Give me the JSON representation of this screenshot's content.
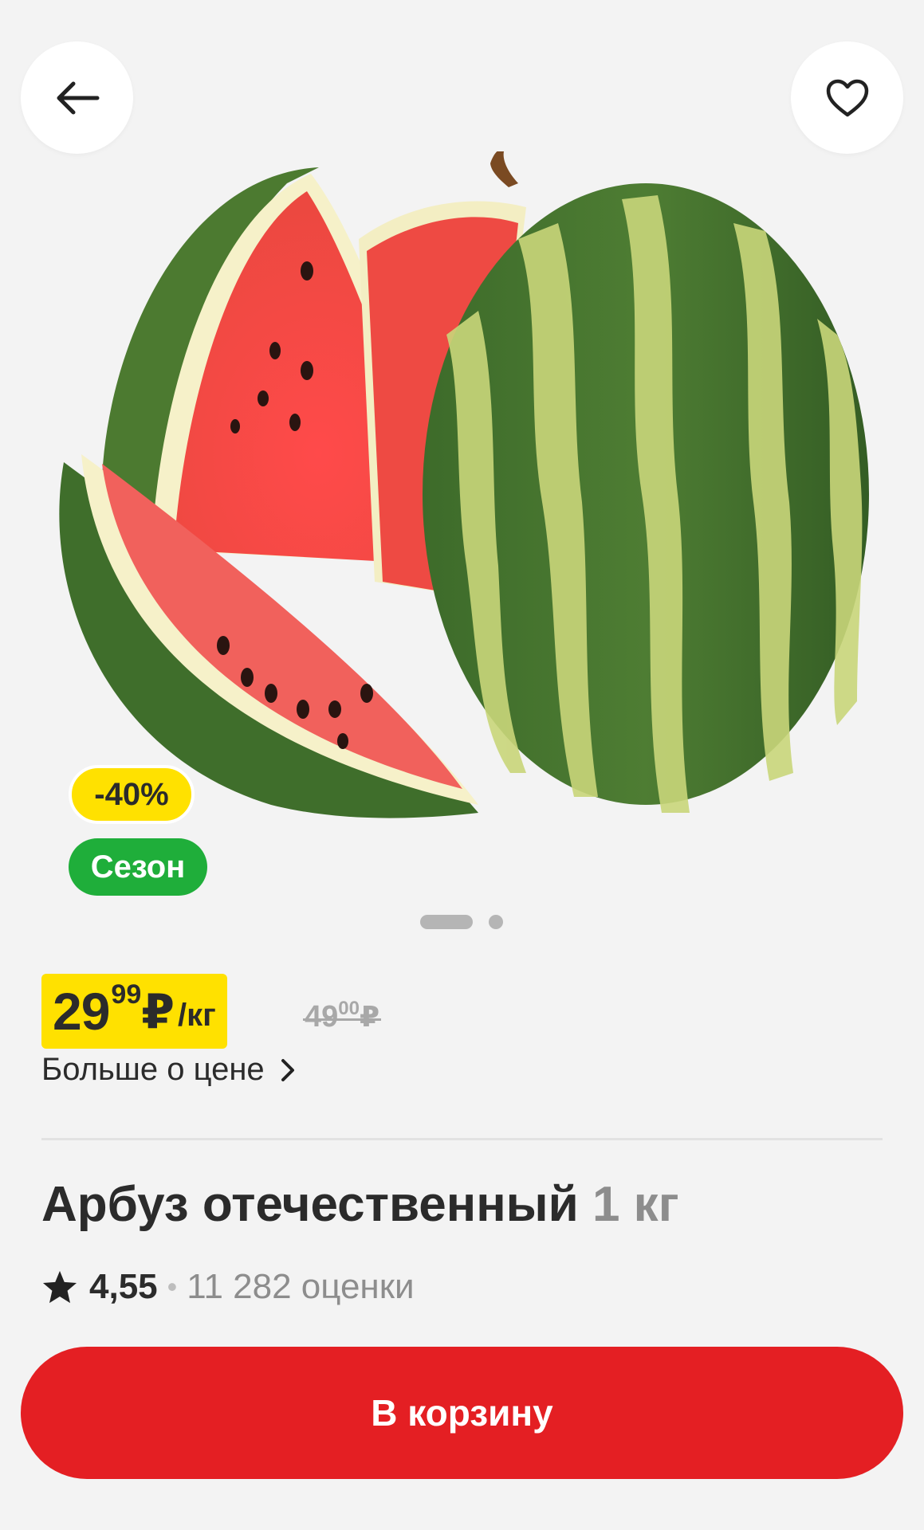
{
  "header": {
    "back_icon": "arrow-left-icon",
    "favorite_icon": "heart-outline-icon"
  },
  "badges": {
    "discount": "-40%",
    "season": "Сезон"
  },
  "gallery": {
    "total_images": 2,
    "active_index": 0
  },
  "price": {
    "integer": "29",
    "fraction": "99",
    "currency": "₽",
    "unit": "/кг",
    "old_integer": "49",
    "old_fraction": "00",
    "old_currency": "₽",
    "more_label": "Больше о цене"
  },
  "product": {
    "name": "Арбуз отечественный",
    "weight": "1 кг",
    "rating": "4,55",
    "separator": "•",
    "reviews": "11 282 оценки"
  },
  "cart_button": {
    "label": "В корзину"
  },
  "colors": {
    "accent_red": "#e41f23",
    "price_yellow": "#ffe100",
    "season_green": "#1fae3a",
    "background": "#f3f3f3"
  }
}
